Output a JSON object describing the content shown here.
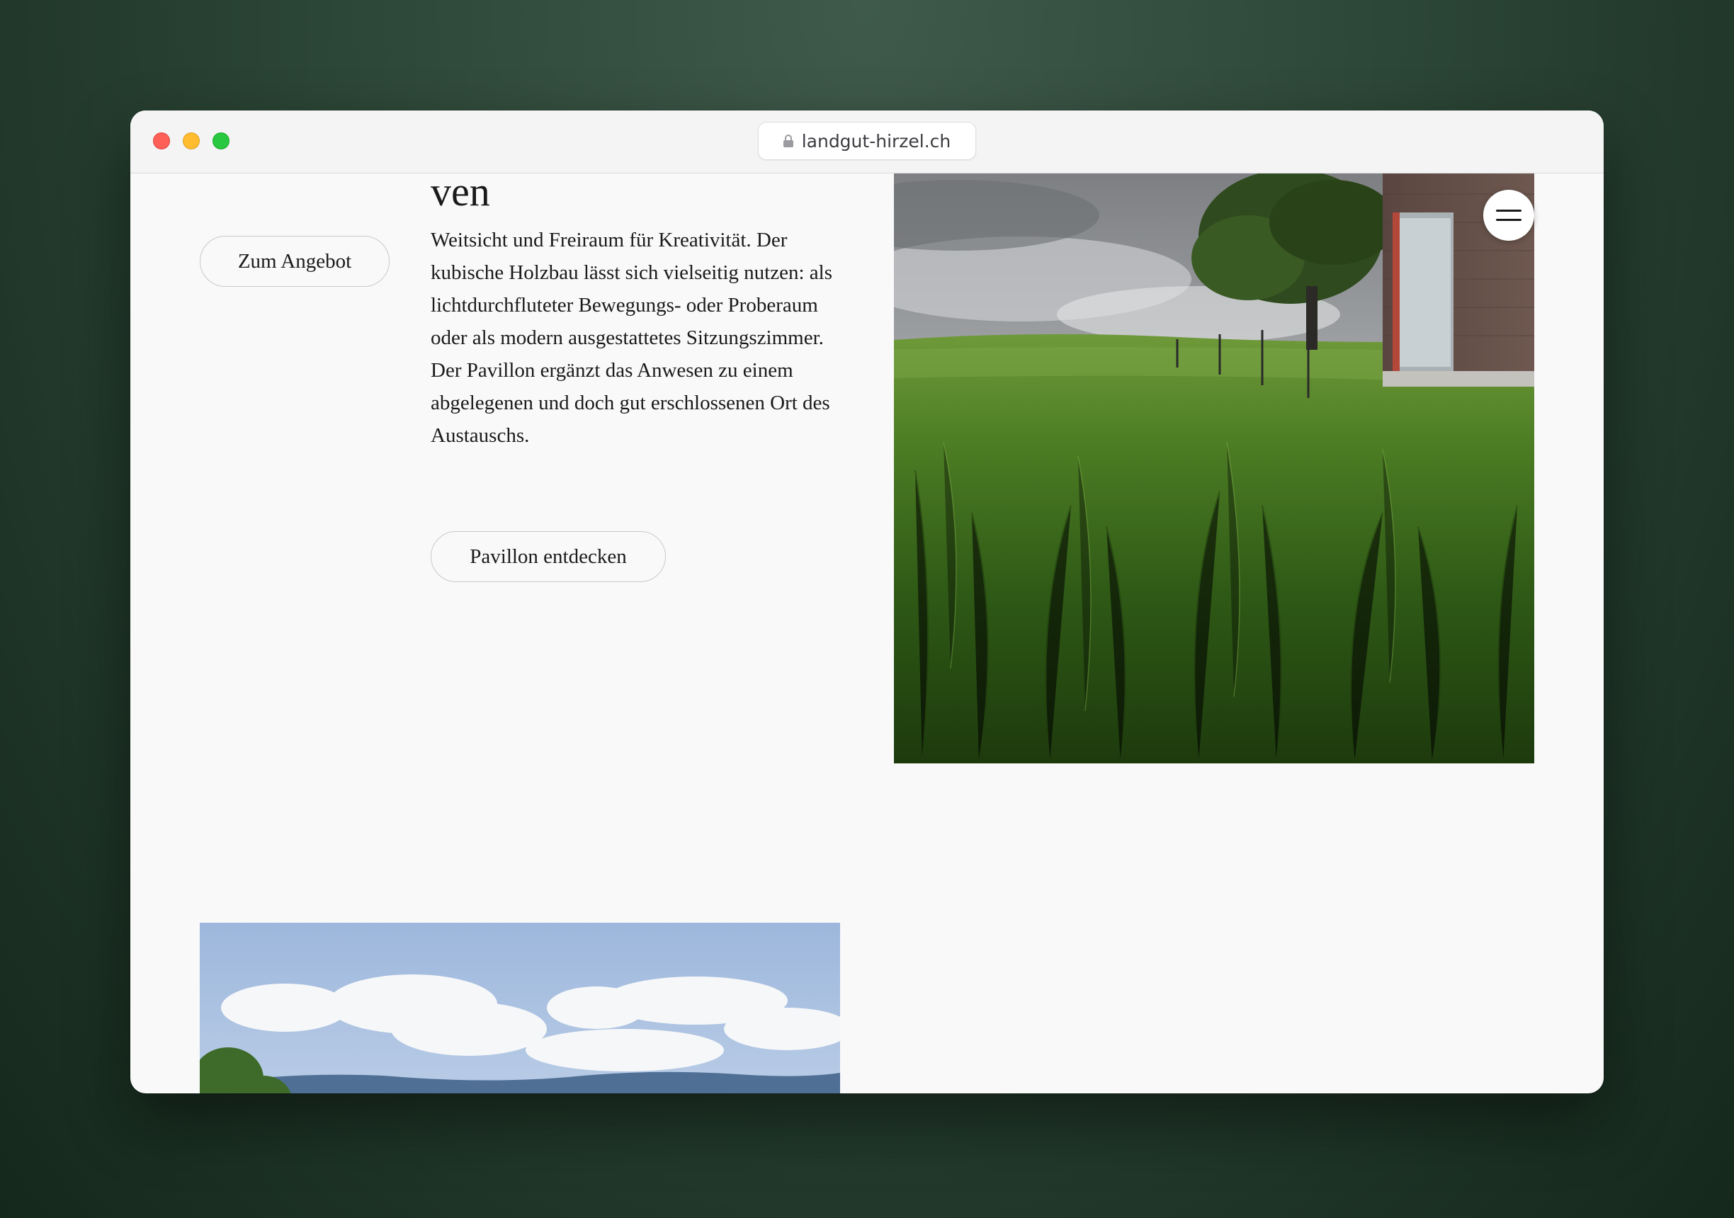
{
  "browser": {
    "url": "landgut-hirzel.ch"
  },
  "page": {
    "offer_button": "Zum Angebot",
    "headline_fragment": "ven",
    "description": "Weitsicht und Freiraum für Kreativität. Der kubische Holzbau lässt sich vielseitig nutzen: als lichtdurchfluteter Bewegungs- oder Probe­raum oder als modern ausgestattetes Sitzungs­zimmer. Der Pavillon ergänzt das Anwesen zu einem abgelegenen und doch gut erschlosse­nen Ort des Austauschs.",
    "pavillon_button": "Pavillon entdecken"
  },
  "icons": {
    "menu": "hamburger-menu-icon",
    "lock": "lock-icon"
  },
  "colors": {
    "background": "#f9f9f9",
    "text": "#1a1a1a",
    "button_border": "#c9c9c9"
  }
}
